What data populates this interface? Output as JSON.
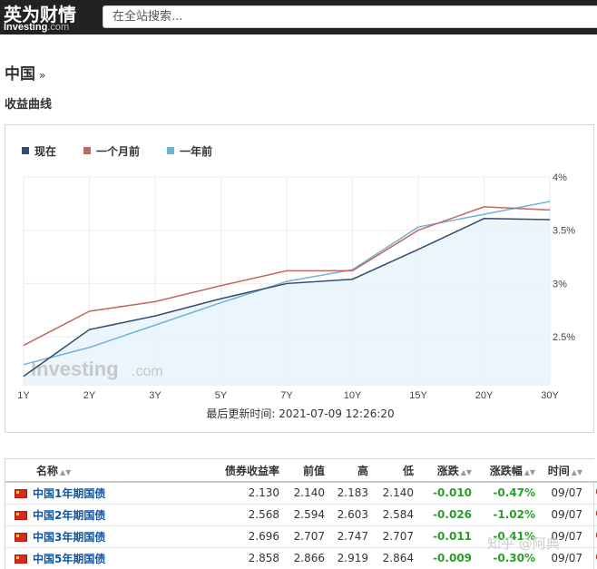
{
  "header": {
    "logo_cn": "英为财情",
    "logo_en": "Investing",
    "logo_domain": ".com",
    "search_placeholder": "在全站搜索..."
  },
  "page_title": "中国",
  "page_title_arrow": "»",
  "section_title": "收益曲线",
  "legend": [
    {
      "label": "现在",
      "color": "#354a70"
    },
    {
      "label": "一个月前",
      "color": "#c0675f"
    },
    {
      "label": "一年前",
      "color": "#6fb4d6"
    }
  ],
  "chart_watermark": "Investing",
  "chart_watermark_domain": ".com",
  "chart_data": {
    "type": "line",
    "categories": [
      "1Y",
      "2Y",
      "3Y",
      "5Y",
      "7Y",
      "10Y",
      "15Y",
      "20Y",
      "30Y"
    ],
    "series": [
      {
        "name": "现在",
        "color": "#354a70",
        "values": [
          2.13,
          2.568,
          2.696,
          2.858,
          3.0,
          3.04,
          3.32,
          3.61,
          3.6
        ]
      },
      {
        "name": "一个月前",
        "color": "#c0675f",
        "values": [
          2.42,
          2.74,
          2.83,
          2.98,
          3.12,
          3.12,
          3.5,
          3.72,
          3.69
        ]
      },
      {
        "name": "一年前",
        "color": "#6fb4d6",
        "values": [
          2.24,
          2.4,
          2.61,
          2.82,
          3.02,
          3.13,
          3.53,
          3.65,
          3.77
        ]
      }
    ],
    "yticks": [
      "2.5%",
      "3%",
      "3.5%",
      "4%"
    ],
    "ytick_values": [
      2.5,
      3.0,
      3.5,
      4.0
    ],
    "ylim": [
      2.05,
      4.0
    ],
    "grid": true,
    "legend_position": "top-left",
    "area_series": "现在"
  },
  "updated_label": "最后更新时间: 2021-07-09 12:26:20",
  "table": {
    "headers": [
      "名称",
      "债券收益率",
      "前值",
      "高",
      "低",
      "涨跌",
      "涨跌幅",
      "时间"
    ],
    "rows": [
      {
        "name": "中国1年期国债",
        "yield": "2.130",
        "prev": "2.140",
        "high": "2.183",
        "low": "2.140",
        "chg": "-0.010",
        "chg_pct": "-0.47%",
        "time": "09/07"
      },
      {
        "name": "中国2年期国债",
        "yield": "2.568",
        "prev": "2.594",
        "high": "2.603",
        "low": "2.584",
        "chg": "-0.026",
        "chg_pct": "-1.02%",
        "time": "09/07"
      },
      {
        "name": "中国3年期国债",
        "yield": "2.696",
        "prev": "2.707",
        "high": "2.747",
        "low": "2.707",
        "chg": "-0.011",
        "chg_pct": "-0.41%",
        "time": "09/07"
      },
      {
        "name": "中国5年期国债",
        "yield": "2.858",
        "prev": "2.866",
        "high": "2.919",
        "low": "2.864",
        "chg": "-0.009",
        "chg_pct": "-0.30%",
        "time": "09/07"
      }
    ]
  },
  "watermark": "知乎 @阿典"
}
